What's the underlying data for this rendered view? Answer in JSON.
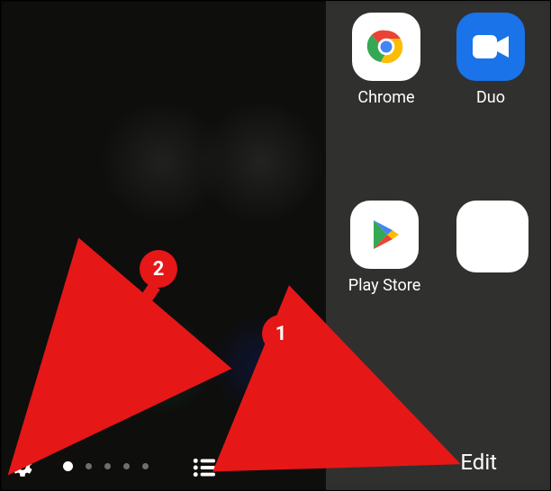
{
  "panel": {
    "apps": [
      {
        "label": "Chrome",
        "icon": "chrome"
      },
      {
        "label": "Duo",
        "icon": "duo"
      },
      {
        "label": "Play Store",
        "icon": "play"
      }
    ],
    "edit_label": "Edit"
  },
  "pagination": {
    "page_count": 5,
    "active_index": 0
  },
  "annotations": {
    "marker1": "1",
    "marker2": "2"
  },
  "colors": {
    "annotation_red": "#e61717",
    "duo_blue": "#1a73e8"
  }
}
